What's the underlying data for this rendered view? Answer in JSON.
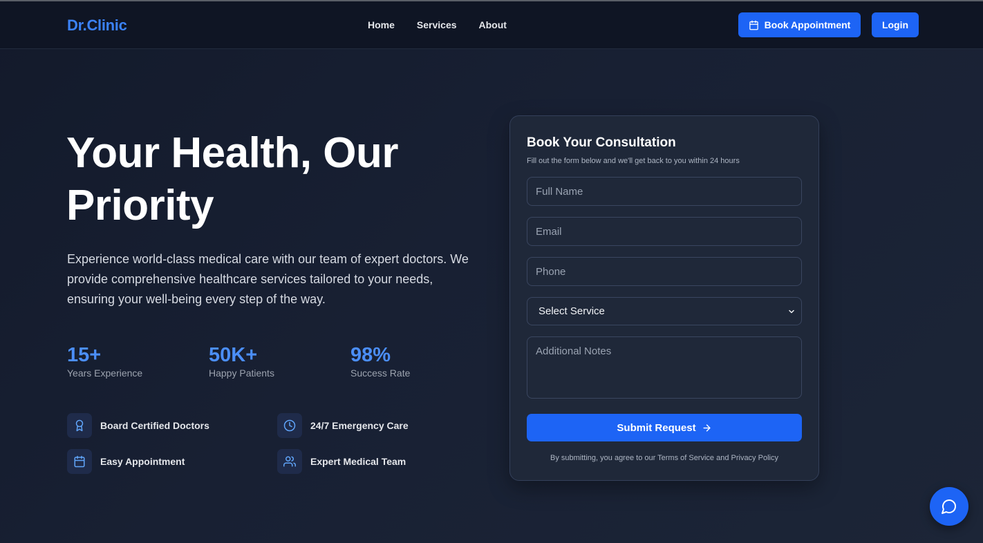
{
  "brand": "Dr.Clinic",
  "nav": {
    "items": [
      "Home",
      "Services",
      "About"
    ]
  },
  "header": {
    "book_label": "Book Appointment",
    "login_label": "Login"
  },
  "hero": {
    "title": "Your Health, Our Priority",
    "description": "Experience world-class medical care with our team of expert doctors. We provide comprehensive healthcare services tailored to your needs, ensuring your well-being every step of the way."
  },
  "stats": [
    {
      "value": "15+",
      "label": "Years Experience"
    },
    {
      "value": "50K+",
      "label": "Happy Patients"
    },
    {
      "value": "98%",
      "label": "Success Rate"
    }
  ],
  "features": [
    {
      "label": "Board Certified Doctors",
      "icon": "award-icon"
    },
    {
      "label": "24/7 Emergency Care",
      "icon": "clock-icon"
    },
    {
      "label": "Easy Appointment",
      "icon": "calendar-icon"
    },
    {
      "label": "Expert Medical Team",
      "icon": "users-icon"
    }
  ],
  "form": {
    "title": "Book Your Consultation",
    "subtitle": "Fill out the form below and we'll get back to you within 24 hours",
    "full_name_placeholder": "Full Name",
    "email_placeholder": "Email",
    "phone_placeholder": "Phone",
    "service_selected": "Select Service",
    "notes_placeholder": "Additional Notes",
    "submit_label": "Submit Request",
    "terms": "By submitting, you agree to our Terms of Service and Privacy Policy"
  },
  "colors": {
    "accent": "#1d64f5",
    "stat": "#4b8ef7",
    "background": "#161d2e",
    "card": "#1f2839"
  },
  "icons": {
    "chat": "chat-bubble-icon",
    "book": "calendar-icon",
    "submit": "arrow-right-icon",
    "select": "chevron-down-icon"
  }
}
